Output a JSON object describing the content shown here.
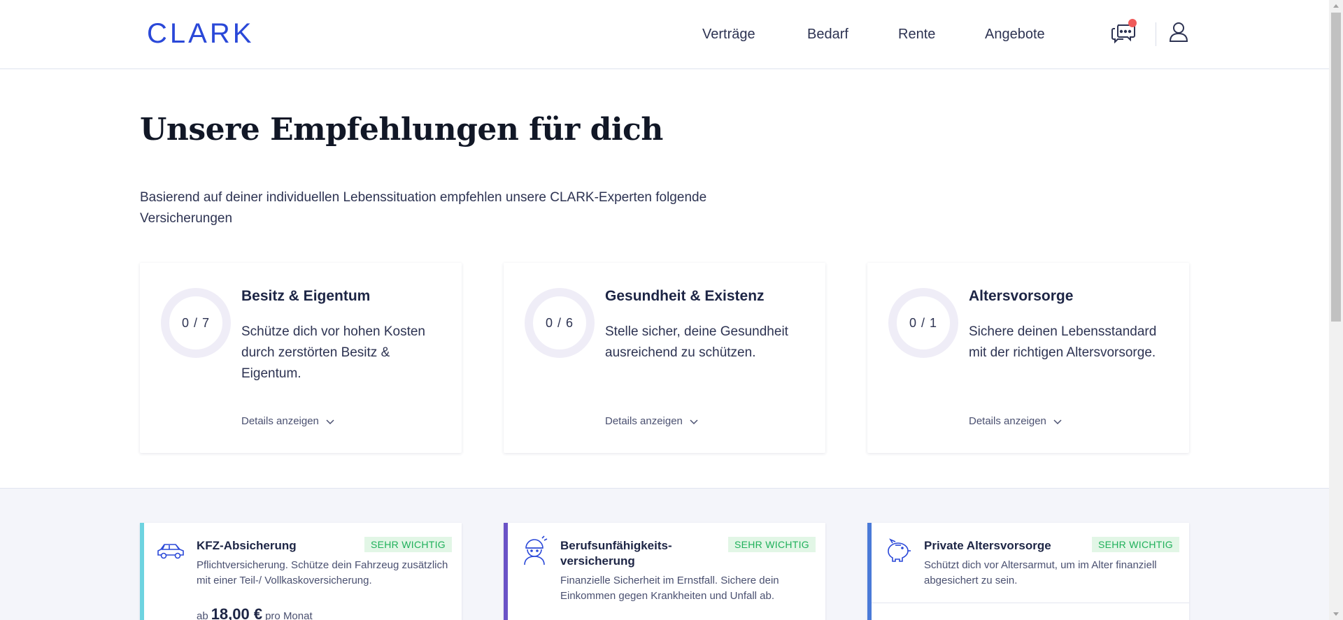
{
  "header": {
    "logo": "CLARK",
    "nav": [
      "Verträge",
      "Bedarf",
      "Rente",
      "Angebote"
    ]
  },
  "hero": {
    "title": "Unsere Empfehlungen für dich",
    "intro": "Basierend auf deiner individuellen Lebenssituation empfehlen unsere CLARK-Experten folgende Versicherungen"
  },
  "categories": [
    {
      "progress": "0 / 7",
      "title": "Besitz & Eigentum",
      "description": "Schütze dich vor hohen Kosten durch zerstörten Besitz & Eigentum.",
      "details": "Details anzeigen"
    },
    {
      "progress": "0 / 6",
      "title": "Gesundheit & Existenz",
      "description": "Stelle sicher, deine Gesundheit ausreichend zu schützen.",
      "details": "Details anzeigen"
    },
    {
      "progress": "0 / 1",
      "title": "Altersvorsorge",
      "description": "Sichere deinen Lebensstandard mit der richtigen Altersvorsorge.",
      "details": "Details anzeigen"
    }
  ],
  "recommendations": [
    {
      "icon": "car-icon",
      "title": "KFZ-Absicherung",
      "badge": "SEHR WICHTIG",
      "description": "Pflichtversicherung. Schütze dein Fahrzeug zusätzlich mit einer Teil-/ Vollkaskoversicherung.",
      "price_prefix": "ab",
      "price": "18,00 €",
      "price_suffix": "pro Monat",
      "accent": "#6ed3e0"
    },
    {
      "icon": "worker-icon",
      "title": "Berufsunfähigkeits-versicherung",
      "badge": "SEHR WICHTIG",
      "description": "Finanzielle Sicherheit im Ernstfall. Sichere dein Einkommen gegen Krankheiten und Unfall ab.",
      "accent": "#6a52c6"
    },
    {
      "icon": "piggy-bank-icon",
      "title": "Private Altersvorsorge",
      "badge": "SEHR WICHTIG",
      "description": "Schützt dich vor Altersarmut, um im Alter finanziell abgesichert zu sein.",
      "accent": "#4a7ad8"
    }
  ],
  "colors": {
    "brand": "#2a48d8",
    "badge_text": "#1fb05a",
    "badge_bg": "#e2f6e6",
    "notification": "#ef5a5a"
  }
}
